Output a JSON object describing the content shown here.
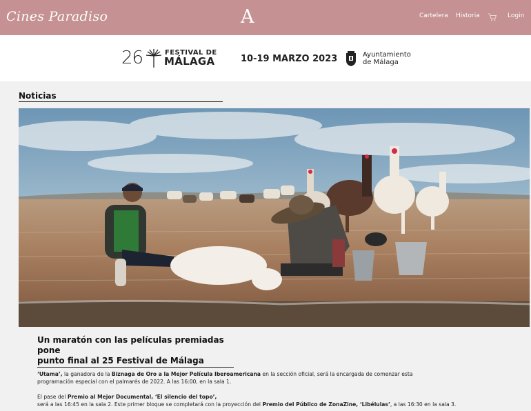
{
  "header": {
    "brand": "Cines Paradiso",
    "logo_letter": "A",
    "nav": {
      "cartelera": "Cartelera",
      "historia": "Historia",
      "login": "Login"
    },
    "cart_icon": "cart-icon",
    "background": "#c59192"
  },
  "banner": {
    "edition": "26",
    "festival_line1": "FESTIVAL DE",
    "festival_line2": "MÁLAGA",
    "dates": "10-19 MARZO 2023",
    "ayto_line1": "Ayuntamiento",
    "ayto_line2": "de Málaga"
  },
  "section": {
    "title": "Noticias"
  },
  "article": {
    "title_line1": "Un maratón con las películas premiadas pone",
    "title_line2": "punto final al 25 Festival de Málaga",
    "p1": {
      "a": "‘Utama’,",
      "b": " la ganadora de la ",
      "c": "Biznaga de Oro a la Mejor Película Iberoamericana",
      "d": " en la sección oficial, será la encargada de comenzar esta",
      "e": "programación especial con el palmarés de 2022. A las 16:00, en la sala 1."
    },
    "p2": {
      "a": "El pase del ",
      "b": "Premio al Mejor Documental, ‘El silencio del topo’,",
      "c": "será a las 16:45 en la sala 2. Este primer bloque se completará con la proyección del ",
      "d": "Premio del Público de ZonaZine, ‘Libélulas’",
      "e": ", a las 16:30 en la sala 3."
    }
  }
}
